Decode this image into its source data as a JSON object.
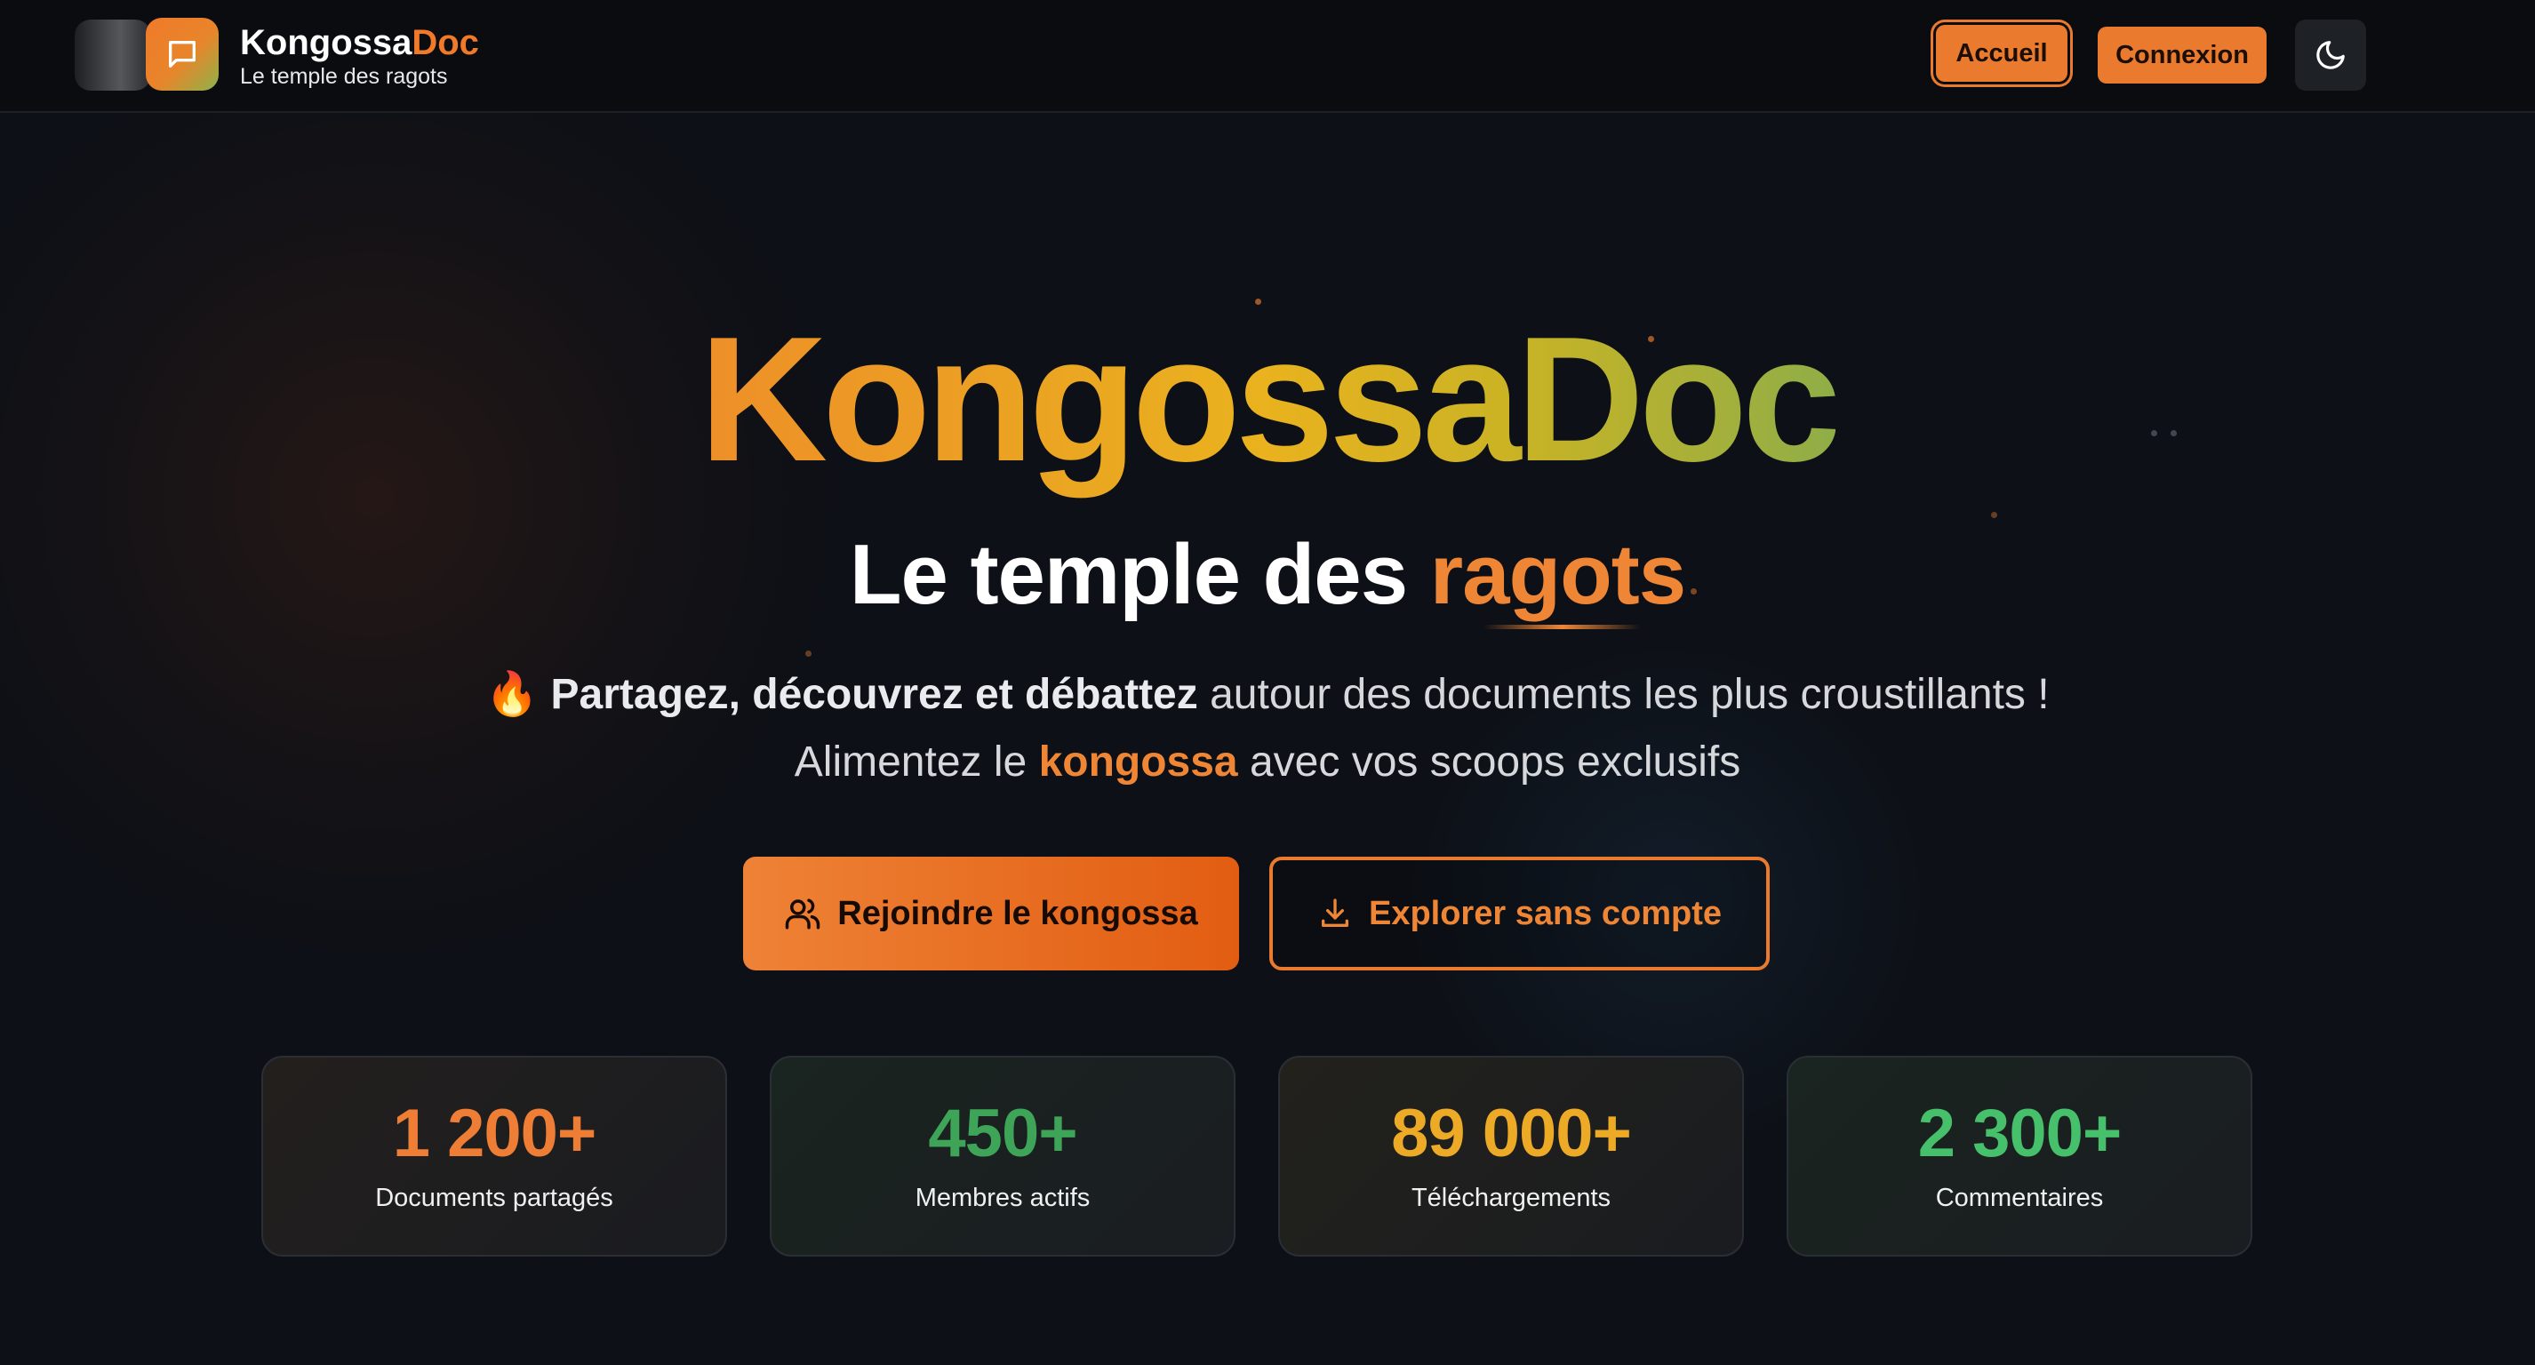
{
  "nav": {
    "brand_name_a": "Kongossa",
    "brand_name_b": "Doc",
    "brand_tagline": "Le temple des ragots",
    "accueil_label": "Accueil",
    "connexion_label": "Connexion",
    "theme_icon": "moon-icon",
    "logo_icon": "chat-bubble-icon"
  },
  "hero": {
    "title": "KongossaDoc",
    "subtitle_lead": "Le temple des ",
    "subtitle_accent": "ragots",
    "line1_emoji": "🔥",
    "line1_bold": "Partagez, découvrez et débattez",
    "line1_rest": " autour des documents les plus croustillants !",
    "line2_lead": "Alimentez le ",
    "line2_accent": "kongossa",
    "line2_rest": " avec vos scoops exclusifs"
  },
  "cta": {
    "join_label": "Rejoindre le kongossa",
    "explore_label": "Explorer sans compte"
  },
  "stats": [
    {
      "value": "1 200+",
      "label": "Documents partagés"
    },
    {
      "value": "450+",
      "label": "Membres actifs"
    },
    {
      "value": "89 000+",
      "label": "Téléchargements"
    },
    {
      "value": "2 300+",
      "label": "Commentaires"
    }
  ],
  "colors": {
    "accent": "#ee8636",
    "background": "#0d1016",
    "green": "#46c06a",
    "gold": "#edaa26"
  }
}
